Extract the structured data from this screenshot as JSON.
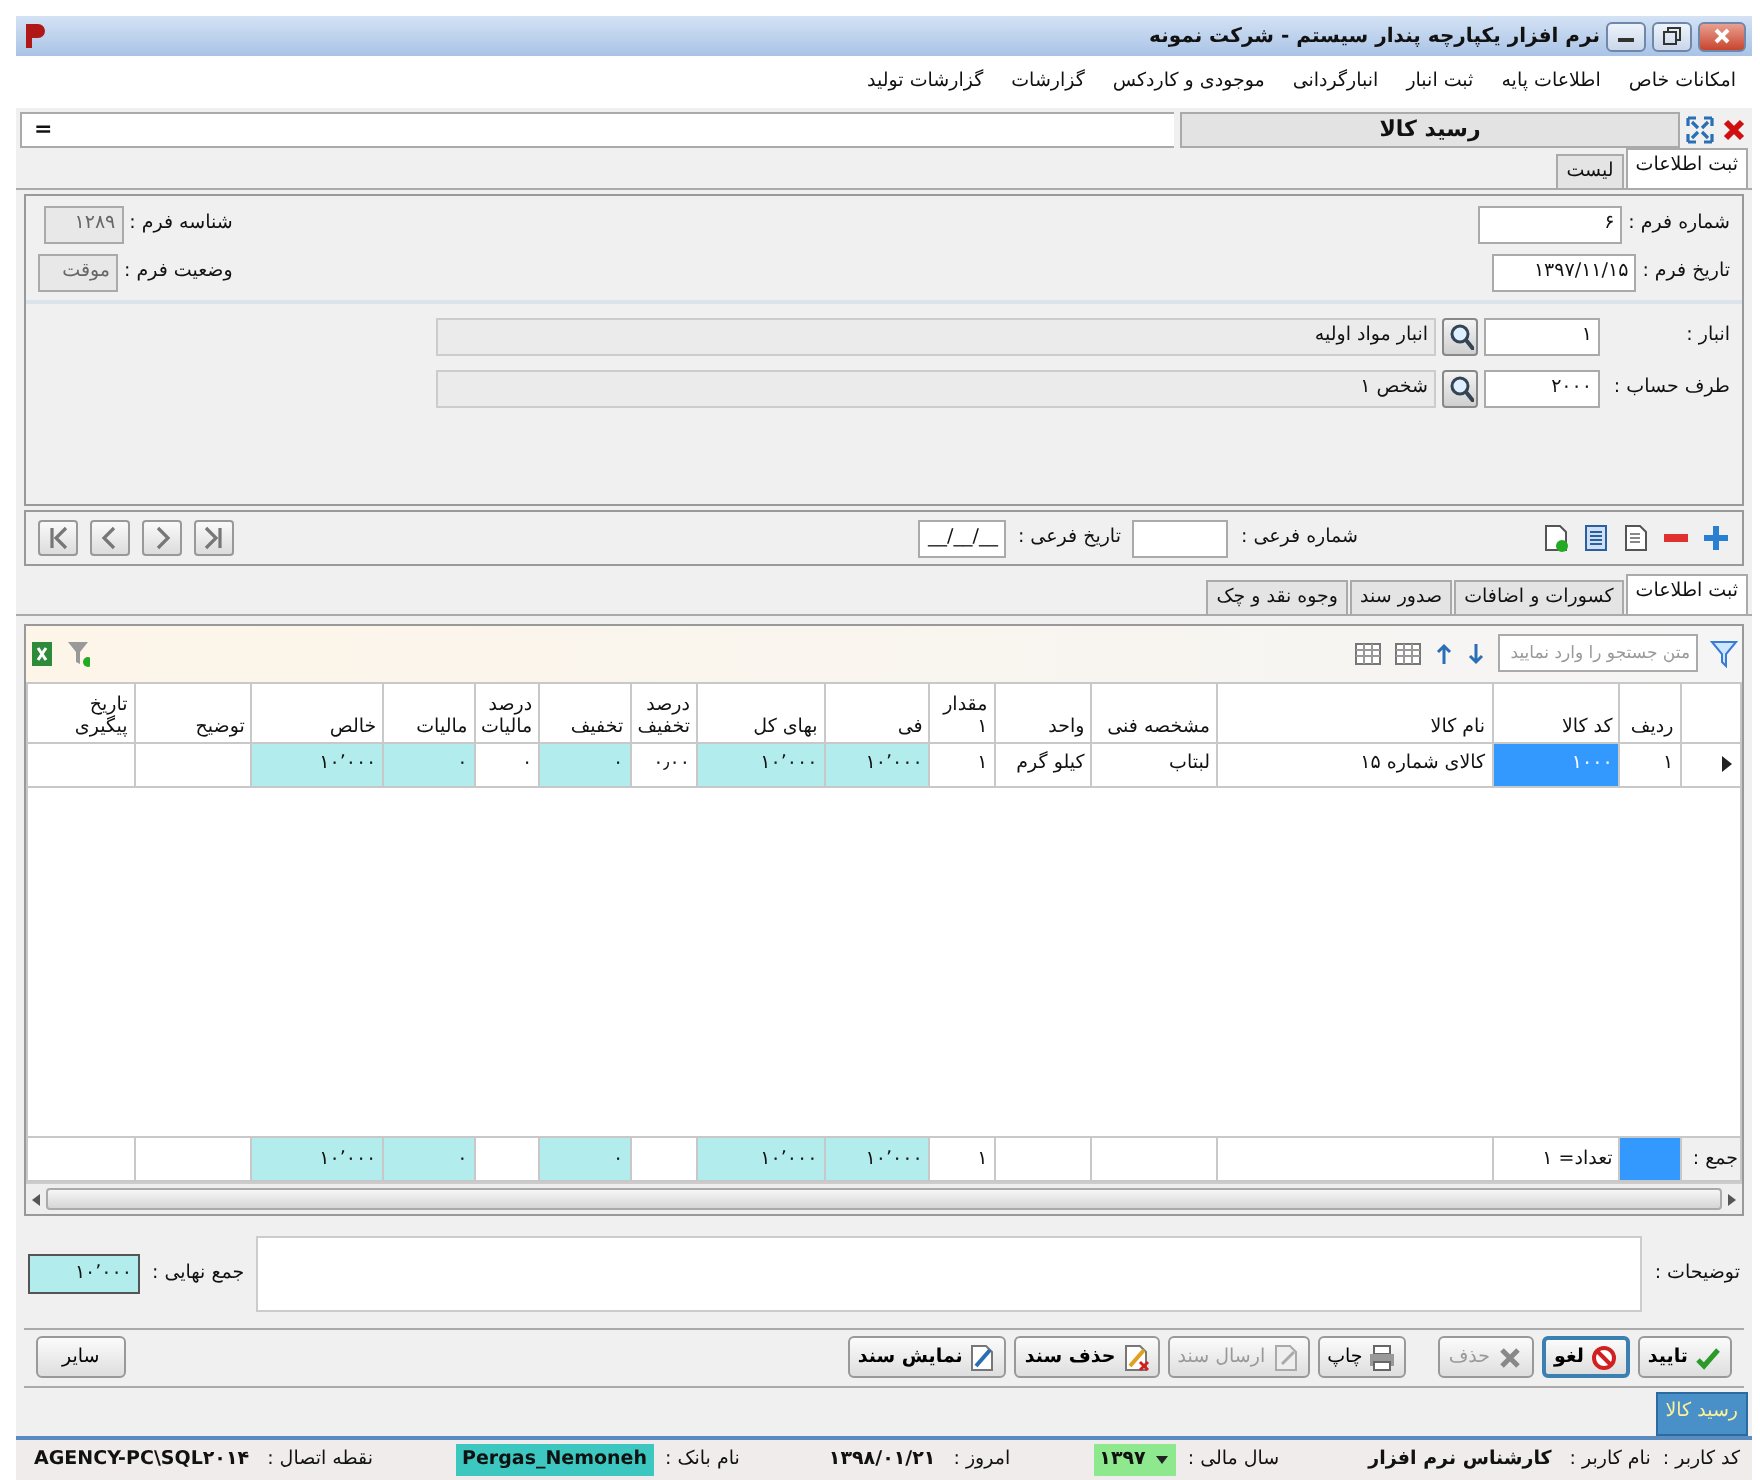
{
  "window": {
    "title": "نرم افزار یکپارچه پندار سیستم - شرکت نمونه"
  },
  "menu": [
    "امکانات خاص",
    "اطلاعات پایه",
    "ثبت انبار",
    "انبارگردانی",
    "موجودی و کاردکس",
    "گزارشات",
    "گزارشات تولید"
  ],
  "document": {
    "title": "رسید کالا",
    "menu_glyph": "="
  },
  "view_tabs": [
    {
      "label": "ثبت اطلاعات",
      "selected": true
    },
    {
      "label": "لیست",
      "selected": false
    }
  ],
  "header_fields": [
    {
      "label": "شماره فرم :",
      "value": "۶",
      "disabled": false
    },
    {
      "label": "تاریخ فرم :",
      "value": "۱۳۹۷/۱۱/۱۵",
      "disabled": false
    }
  ],
  "info_fields": [
    {
      "label": "شناسه فرم :",
      "value": "۱۲۸۹",
      "disabled": true
    },
    {
      "label": "وضعیت فرم :",
      "value": "موقت",
      "disabled": true
    }
  ],
  "lookups": [
    {
      "label": "انبار :",
      "code": "۱",
      "name": "انبار مواد اولیه"
    },
    {
      "label": "طرف حساب :",
      "code": "۲۰۰۰",
      "name": "شخص ۱"
    }
  ],
  "sub_fields": [
    {
      "label": "شماره فرعی :"
    },
    {
      "label": "تاریخ فرعی :",
      "value": "__/__/__"
    }
  ],
  "detail_tabs": [
    {
      "label": "ثبت اطلاعات",
      "selected": true
    },
    {
      "label": "کسورات و اضافات",
      "selected": false
    },
    {
      "label": "صدور سند",
      "selected": false
    },
    {
      "label": "وجوه نقد و چک",
      "selected": false
    }
  ],
  "search": {
    "placeholder": "متن جستجو را وارد نمایید"
  },
  "table": {
    "columns": [
      {
        "label": "ردیف",
        "shaded": false
      },
      {
        "label": "کد کالا",
        "shaded": false
      },
      {
        "label": "نام کالا",
        "shaded": false
      },
      {
        "label": "مشخصه فنی",
        "shaded": false
      },
      {
        "label": "واحد",
        "shaded": false
      },
      {
        "label": "مقدار ۱",
        "shaded": false
      },
      {
        "label": "فی",
        "shaded": true
      },
      {
        "label": "بهای کل",
        "shaded": true
      },
      {
        "label": "درصد تخفیف",
        "shaded": false
      },
      {
        "label": "تخفیف",
        "shaded": true
      },
      {
        "label": "درصد مالیات",
        "shaded": false
      },
      {
        "label": "مالیات",
        "shaded": true
      },
      {
        "label": "خالص",
        "shaded": true
      },
      {
        "label": "توضیح",
        "shaded": false
      },
      {
        "label": "تاریخ پیگیری",
        "shaded": false
      }
    ],
    "rows": [
      {
        "selected": true,
        "cells": [
          {
            "text": "۱",
            "focused": false
          },
          {
            "text": "۱۰۰۰",
            "focused": true
          },
          {
            "text": "کالای شماره ۱۵",
            "focused": false
          },
          {
            "text": "لبتاب",
            "focused": false
          },
          {
            "text": "کیلو گرم",
            "focused": false
          },
          {
            "text": "۱",
            "focused": false
          },
          {
            "text": "۱۰٬۰۰۰",
            "focused": false
          },
          {
            "text": "۱۰٬۰۰۰",
            "focused": false
          },
          {
            "text": "۰٫۰۰",
            "focused": false
          },
          {
            "text": "۰",
            "focused": false
          },
          {
            "text": "۰",
            "focused": false
          },
          {
            "text": "۰",
            "focused": false
          },
          {
            "text": "۱۰٬۰۰۰",
            "focused": false
          },
          {
            "focused": false
          },
          {
            "focused": false
          }
        ]
      }
    ],
    "footer": {
      "label": "جمع :",
      "cells": [
        {
          "focused": true
        },
        {
          "text": "تعداد= ۱",
          "focused": false
        },
        {
          "focused": false
        },
        {
          "focused": false
        },
        {
          "focused": false
        },
        {
          "text": "۱",
          "focused": false
        },
        {
          "text": "۱۰٬۰۰۰",
          "focused": false
        },
        {
          "text": "۱۰٬۰۰۰",
          "focused": false
        },
        {
          "focused": false
        },
        {
          "text": "۰",
          "focused": false
        },
        {
          "focused": false
        },
        {
          "text": "۰",
          "focused": false
        },
        {
          "text": "۱۰٬۰۰۰",
          "focused": false
        },
        {
          "focused": false
        },
        {
          "focused": false
        }
      ]
    }
  },
  "notes": {
    "label": "توضیحات :"
  },
  "grand_total": {
    "label": "جمع نهایی :",
    "value": "۱۰٬۰۰۰"
  },
  "buttons": [
    {
      "label": "تایید",
      "kind": "confirm",
      "disabled": false,
      "bold": true,
      "focused": false
    },
    {
      "label": "لغو",
      "kind": "cancel",
      "disabled": false,
      "bold": true,
      "focused": true
    },
    {
      "label": "حذف",
      "kind": "delete",
      "disabled": true,
      "bold": false,
      "focused": false
    },
    {
      "label": "چاپ",
      "kind": "print",
      "disabled": false,
      "bold": false,
      "focused": false
    },
    {
      "label": "ارسال سند",
      "kind": "send",
      "disabled": true,
      "bold": false,
      "focused": false
    },
    {
      "label": "حذف سند",
      "kind": "remove-doc",
      "disabled": false,
      "bold": true,
      "focused": false
    },
    {
      "label": "نمایش سند",
      "kind": "show-doc",
      "disabled": false,
      "bold": true,
      "focused": false
    }
  ],
  "other_button": "سایر",
  "open_windows": [
    {
      "label": "رسید کالا",
      "selected": true
    }
  ],
  "status_bar": [
    {
      "label": "کد کاربر :"
    },
    {
      "label": "نام کاربر :",
      "value": "کارشناس نرم افزار"
    },
    {
      "label": "سال مالی :",
      "value": "۱۳۹۷",
      "kind": "select",
      "color": "#8ee88e"
    },
    {
      "label": "امروز :",
      "value": "۱۳۹۸/۰۱/۲۱"
    },
    {
      "label": "نام بانک :",
      "value": "Pergas_Nemoneh",
      "color": "#3cc8c0"
    },
    {
      "label": "نقطه اتصال :",
      "value": "AGENCY-PC\\SQL۲۰۱۴"
    }
  ]
}
